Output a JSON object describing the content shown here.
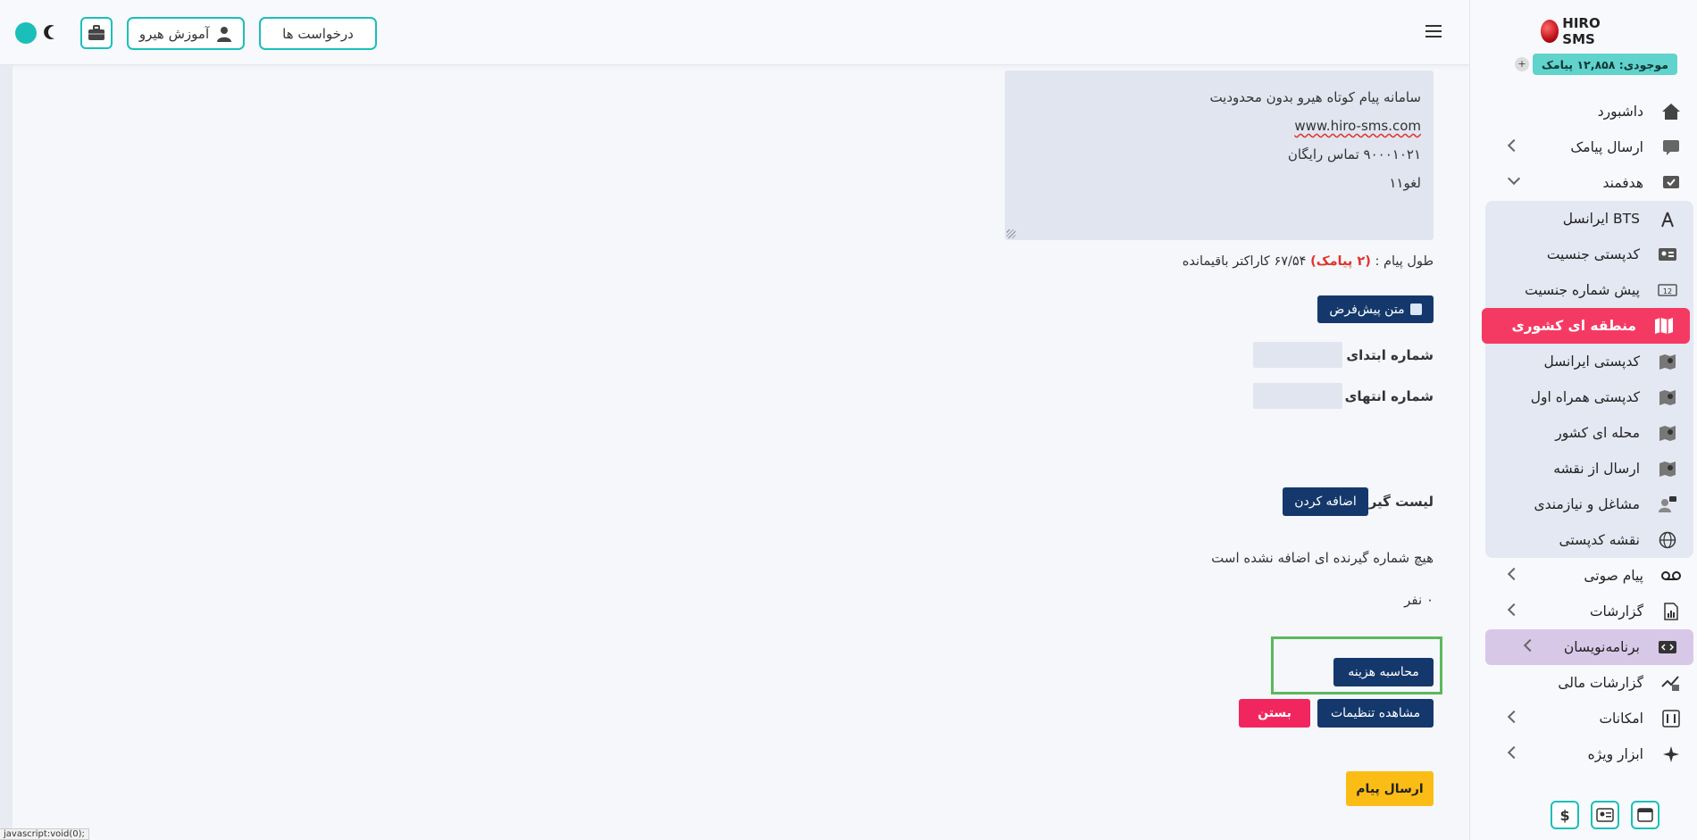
{
  "topbar": {
    "requests_label": "درخواست ها",
    "education_label": "آموزش هیرو"
  },
  "message": {
    "lines": [
      "سامانه پیام کوتاه هیرو بدون محدودیت",
      "www.hiro-sms.com",
      "۹۰۰۰۱۰۲۱ تماس رایگان",
      "لغو۱۱"
    ],
    "length_prefix": "طول پیام :",
    "length_count": "(۲ پیامک)",
    "length_suffix": "۶۷/۵۴ کاراکتر باقیمانده"
  },
  "form": {
    "default_text_button": "متن پیش‌فرض",
    "start_number_label": "شماره ابتدای ارسال :",
    "end_number_label": "شماره انتهای ارسال :",
    "start_number_value": "",
    "end_number_value": "",
    "recipients_label": "لیست گیرندگان :",
    "add_button": "اضافه کردن",
    "no_recipients_text": "هیچ شماره گیرنده ای اضافه نشده است",
    "recipients_count": "۰ نفر",
    "calc_cost_button": "محاسبه هزینه",
    "view_settings_button": "مشاهده تنظیمات",
    "close_button": "بستن",
    "send_button": "ارسال پیام"
  },
  "statusbar_text": "javascript:void(0);",
  "sidebar": {
    "logo_text": "HIRO SMS",
    "balance": "موجودی: ۱۲,۸۵۸ پیامک",
    "balance_plus": "+",
    "items": [
      {
        "label": "داشبورد"
      },
      {
        "label": "ارسال پیامک"
      },
      {
        "label": "هدفمند"
      },
      {
        "label": "BTS ایرانسل"
      },
      {
        "label": "کدپستی جنسیت"
      },
      {
        "label": "پیش شماره جنسیت"
      },
      {
        "label": "منطقه ای کشوری"
      },
      {
        "label": "کدپستی ایرانسل"
      },
      {
        "label": "کدپستی همراه اول"
      },
      {
        "label": "محله ای کشور"
      },
      {
        "label": "ارسال از نقشه"
      },
      {
        "label": "مشاغل و نیازمندی"
      },
      {
        "label": "نقشه کدپستی"
      },
      {
        "label": "پیام صوتی"
      },
      {
        "label": "گزارشات"
      },
      {
        "label": "برنامه‌نویسان"
      },
      {
        "label": "گزارشات مالی"
      },
      {
        "label": "امکانات"
      },
      {
        "label": "ابزار ویژه"
      }
    ],
    "bottom_dollar": "$"
  },
  "colors": {
    "accent": "#1bbfba",
    "navy": "#14386b",
    "active": "#f43a63",
    "warning": "#fbbc16",
    "highlight": "#5cb85c"
  }
}
